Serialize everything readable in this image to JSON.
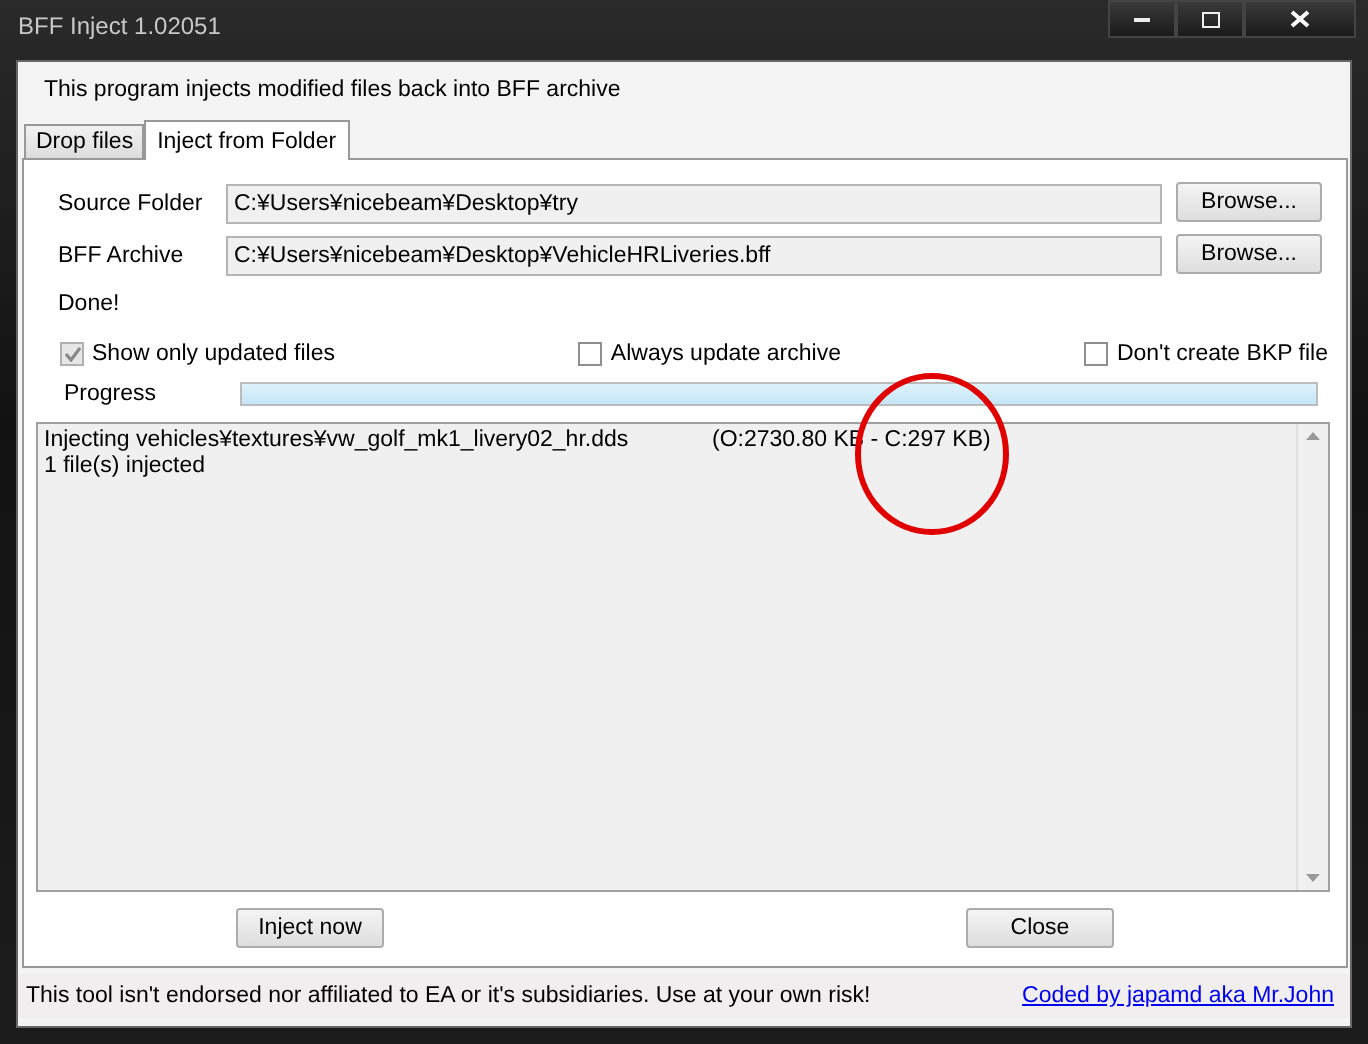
{
  "window": {
    "title": "BFF Inject 1.02051"
  },
  "header": "This program injects modified files back into BFF archive",
  "tabs": [
    {
      "label": "Drop files",
      "selected": false
    },
    {
      "label": "Inject from Folder",
      "selected": true
    }
  ],
  "fields": [
    {
      "label": "Source Folder",
      "value": "C:¥Users¥nicebeam¥Desktop¥try",
      "button": "Browse..."
    },
    {
      "label": "BFF Archive",
      "value": "C:¥Users¥nicebeam¥Desktop¥VehicleHRLiveries.bff",
      "button": "Browse..."
    }
  ],
  "status": "Done!",
  "options": [
    {
      "label": "Show only updated files",
      "checked": true,
      "disabled": true
    },
    {
      "label": "Always update archive",
      "checked": false,
      "disabled": false
    },
    {
      "label": "Don't create BKP file",
      "checked": false,
      "disabled": false
    }
  ],
  "progress": {
    "label": "Progress",
    "level": 1
  },
  "log": [
    {
      "text": "Injecting vehicles¥textures¥vw_golf_mk1_livery02_hr.dds",
      "detail": "(O:2730.80 KB - C:297 KB)"
    },
    {
      "text": "1 file(s) injected"
    }
  ],
  "buttons": [
    "Inject now",
    "Close"
  ],
  "status_bar": {
    "text": "This tool isn't endorsed nor affiliated to EA or it's subsidiaries. Use at your own risk!",
    "link": "Coded by japamd aka Mr.John"
  }
}
